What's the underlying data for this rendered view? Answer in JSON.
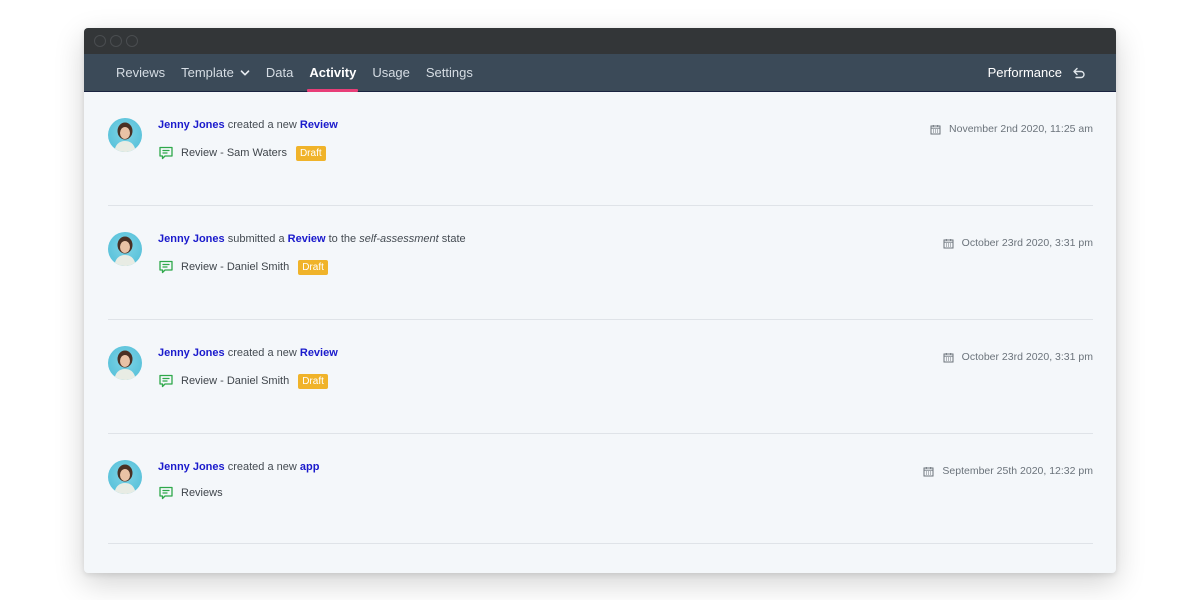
{
  "window": {
    "controls": [
      "close",
      "minimize",
      "maximize"
    ]
  },
  "nav": {
    "items": [
      {
        "label": "Reviews",
        "active": false
      },
      {
        "label": "Template",
        "active": false,
        "dropdown": true
      },
      {
        "label": "Data",
        "active": false
      },
      {
        "label": "Activity",
        "active": true
      },
      {
        "label": "Usage",
        "active": false
      },
      {
        "label": "Settings",
        "active": false
      }
    ],
    "right": {
      "label": "Performance",
      "icon": "undo-arrow-icon"
    },
    "active_underline_color": "#e83e78"
  },
  "activity": [
    {
      "actor": "Jenny Jones",
      "parts": [
        "created a new"
      ],
      "object": "Review",
      "item_icon": "comment-icon",
      "item": "Review - Sam Waters",
      "badge": "Draft",
      "date": "November 2nd 2020, 11:25 am"
    },
    {
      "actor": "Jenny Jones",
      "verb": "submitted a",
      "object": "Review",
      "to": "to the",
      "state": "self-assessment",
      "state_suffix": "state",
      "item_icon": "comment-icon",
      "item": "Review - Daniel Smith",
      "badge": "Draft",
      "date": "October 23rd 2020, 3:31 pm"
    },
    {
      "actor": "Jenny Jones",
      "verb": "created a new",
      "object": "Review",
      "item_icon": "comment-icon",
      "item": "Review - Daniel Smith",
      "badge": "Draft",
      "date": "October 23rd 2020, 3:31 pm"
    },
    {
      "actor": "Jenny Jones",
      "verb": "created a new",
      "object": "app",
      "item_icon": "comment-icon",
      "item": "Reviews",
      "date": "September 25th 2020, 12:32 pm"
    }
  ],
  "colors": {
    "link": "#1a1acc",
    "badge": "#f0b32a",
    "nav_bg": "#3b4a58",
    "icon_green": "#2ea84a"
  }
}
